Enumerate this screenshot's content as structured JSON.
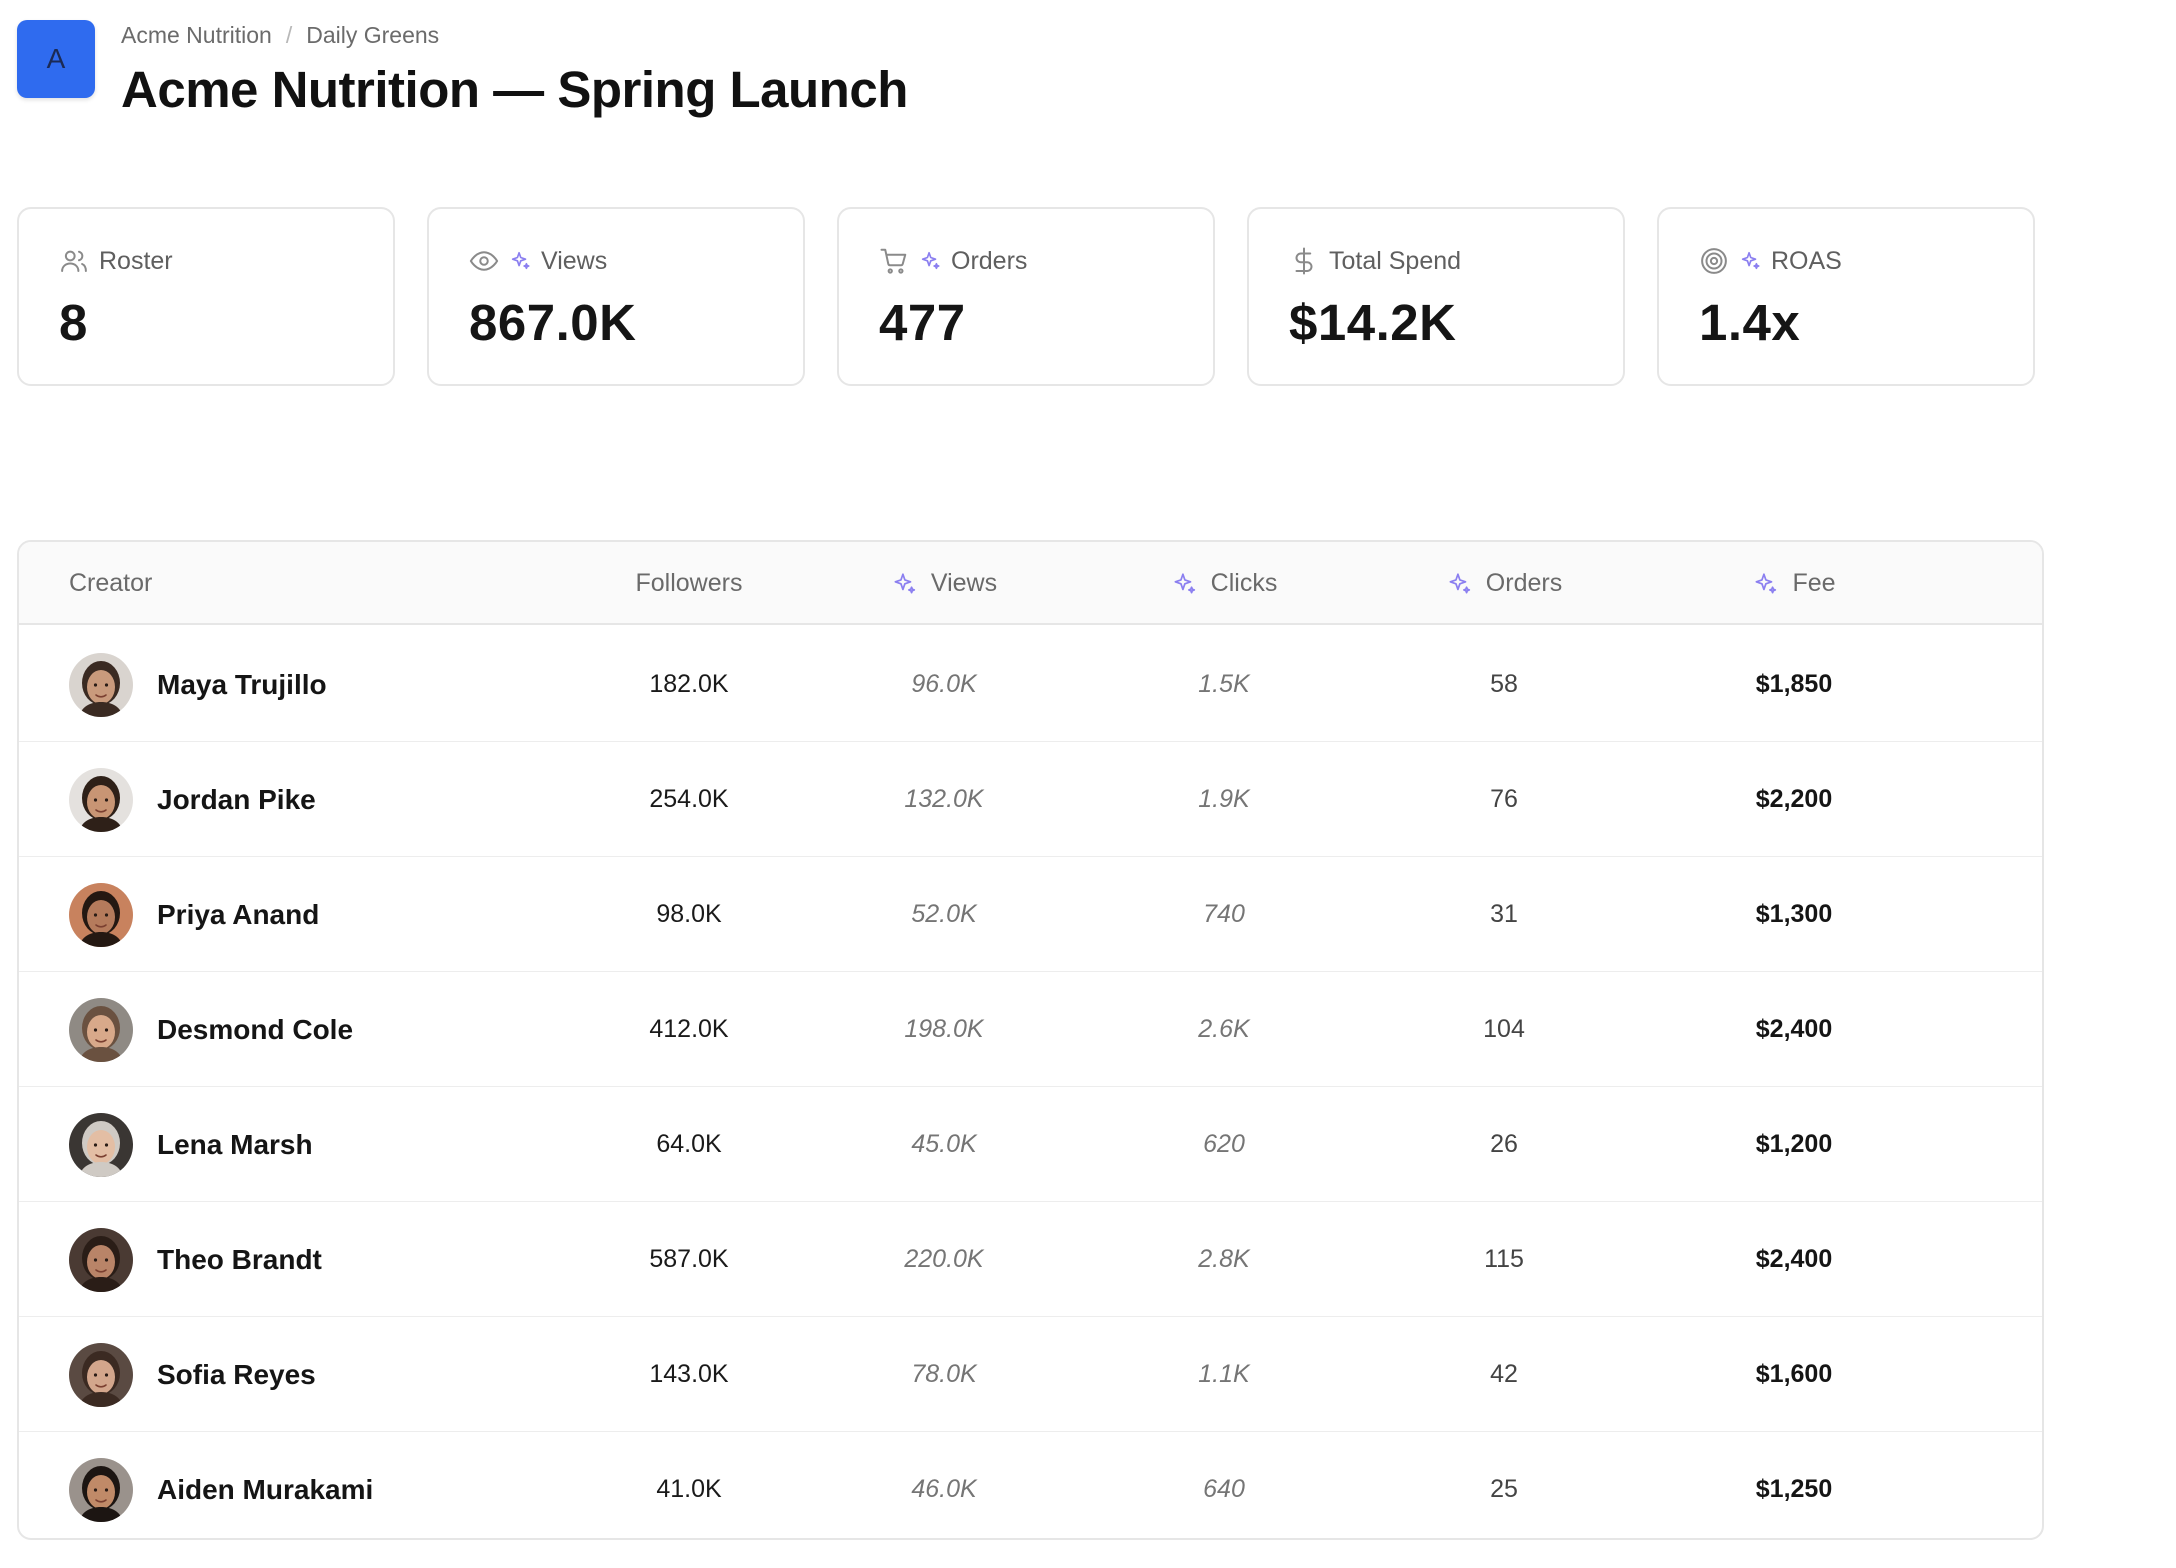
{
  "header": {
    "logo_letter": "A",
    "breadcrumb": [
      "Acme Nutrition",
      "Daily Greens"
    ],
    "breadcrumb_separator": "/",
    "title": "Acme Nutrition — Spring Launch"
  },
  "stats": [
    {
      "label": "Roster",
      "value": "8",
      "icon": "users-icon",
      "sparkle": false
    },
    {
      "label": "Views",
      "value": "867.0K",
      "icon": "eye-icon",
      "sparkle": true
    },
    {
      "label": "Orders",
      "value": "477",
      "icon": "cart-icon",
      "sparkle": true
    },
    {
      "label": "Total Spend",
      "value": "$14.2K",
      "icon": "dollar-icon",
      "sparkle": false
    },
    {
      "label": "ROAS",
      "value": "1.4x",
      "icon": "target-icon",
      "sparkle": true
    }
  ],
  "table": {
    "columns": [
      {
        "label": "Creator",
        "sparkle": false
      },
      {
        "label": "Followers",
        "sparkle": false
      },
      {
        "label": "Views",
        "sparkle": true
      },
      {
        "label": "Clicks",
        "sparkle": true
      },
      {
        "label": "Orders",
        "sparkle": true
      },
      {
        "label": "Fee",
        "sparkle": true
      }
    ],
    "rows": [
      {
        "name": "Maya Trujillo",
        "followers": "182.0K",
        "views": "96.0K",
        "clicks": "1.5K",
        "orders": "58",
        "fee": "$1,850",
        "avatar_skin": "#c99a7c",
        "avatar_hair": "#3a2a22",
        "avatar_bg": "#d9d4cf"
      },
      {
        "name": "Jordan Pike",
        "followers": "254.0K",
        "views": "132.0K",
        "clicks": "1.9K",
        "orders": "76",
        "fee": "$2,200",
        "avatar_skin": "#c89574",
        "avatar_hair": "#2e2018",
        "avatar_bg": "#e4e1de"
      },
      {
        "name": "Priya Anand",
        "followers": "98.0K",
        "views": "52.0K",
        "clicks": "740",
        "orders": "31",
        "fee": "$1,300",
        "avatar_skin": "#b57b5c",
        "avatar_hair": "#241812",
        "avatar_bg": "#c8825e"
      },
      {
        "name": "Desmond Cole",
        "followers": "412.0K",
        "views": "198.0K",
        "clicks": "2.6K",
        "orders": "104",
        "fee": "$2,400",
        "avatar_skin": "#d8a98a",
        "avatar_hair": "#6a5140",
        "avatar_bg": "#8f8a84"
      },
      {
        "name": "Lena Marsh",
        "followers": "64.0K",
        "views": "45.0K",
        "clicks": "620",
        "orders": "26",
        "fee": "$1,200",
        "avatar_skin": "#e3bea4",
        "avatar_hair": "#cfcac4",
        "avatar_bg": "#3a3633"
      },
      {
        "name": "Theo Brandt",
        "followers": "587.0K",
        "views": "220.0K",
        "clicks": "2.8K",
        "orders": "115",
        "fee": "$2,400",
        "avatar_skin": "#b98468",
        "avatar_hair": "#2a1d17",
        "avatar_bg": "#4a3a33"
      },
      {
        "name": "Sofia Reyes",
        "followers": "143.0K",
        "views": "78.0K",
        "clicks": "1.1K",
        "orders": "42",
        "fee": "$1,600",
        "avatar_skin": "#d3a68c",
        "avatar_hair": "#3b2a22",
        "avatar_bg": "#5a4a42"
      },
      {
        "name": "Aiden Murakami",
        "followers": "41.0K",
        "views": "46.0K",
        "clicks": "640",
        "orders": "25",
        "fee": "$1,250",
        "avatar_skin": "#c08a68",
        "avatar_hair": "#1c1512",
        "avatar_bg": "#9a928c"
      }
    ]
  },
  "colors": {
    "accent": "#2f6bef",
    "sparkle": "#8b7ff0",
    "border": "#e6e6e6",
    "muted_text": "#757575"
  }
}
